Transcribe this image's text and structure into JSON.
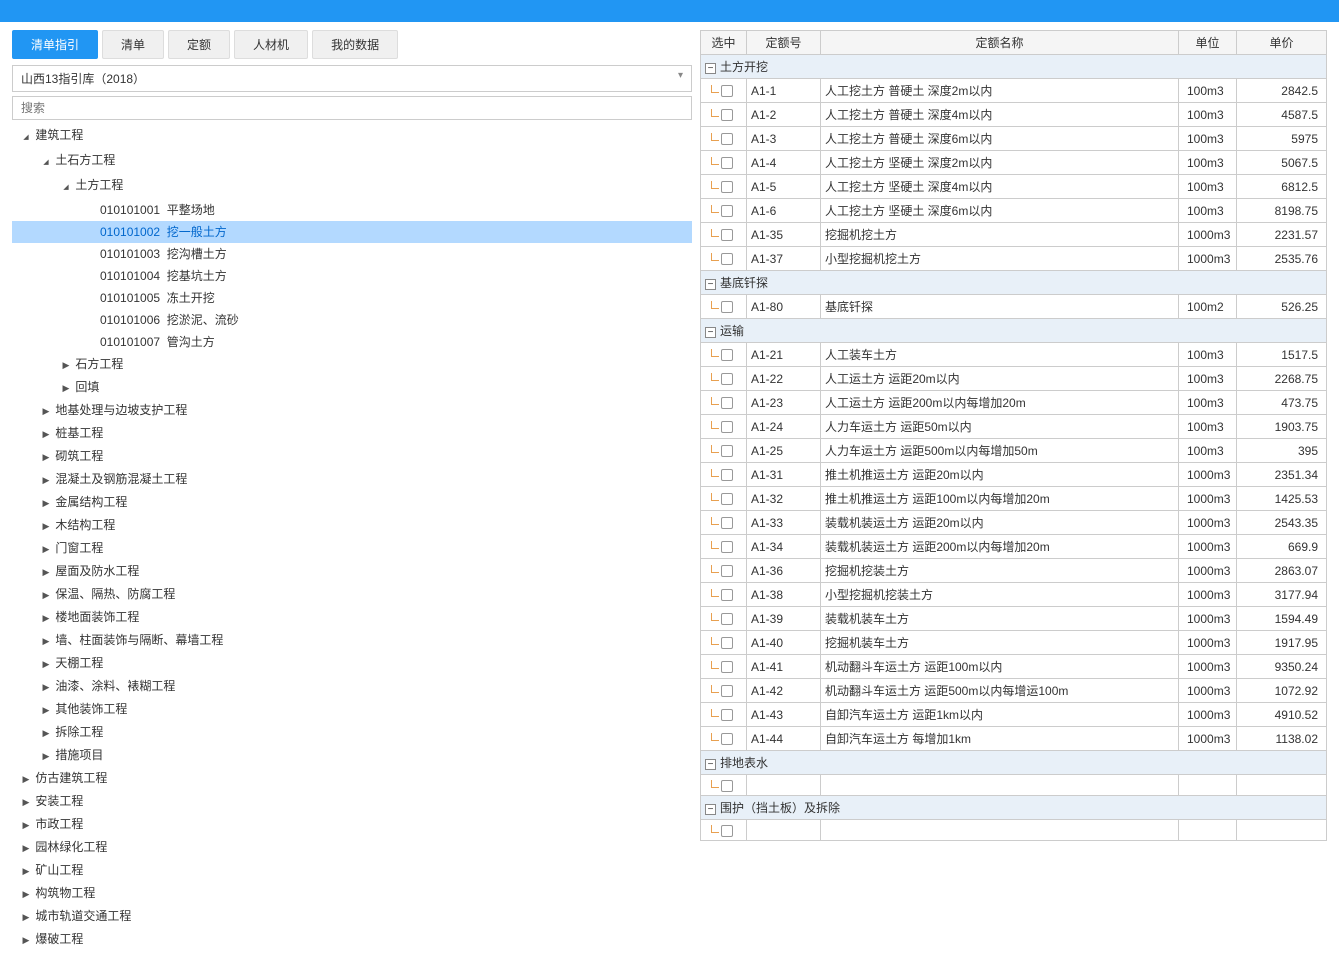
{
  "tabs": [
    "清单指引",
    "清单",
    "定额",
    "人材机",
    "我的数据"
  ],
  "activeTab": 0,
  "library": "山西13指引库（2018）",
  "searchPlaceholder": "搜索",
  "tree": [
    {
      "label": "建筑工程",
      "depth": 0,
      "caret": "open",
      "children": [
        {
          "label": "土石方工程",
          "depth": 1,
          "caret": "open",
          "children": [
            {
              "label": "土方工程",
              "depth": 2,
              "caret": "open",
              "children": [
                {
                  "code": "010101001",
                  "label": "平整场地",
                  "depth": 3
                },
                {
                  "code": "010101002",
                  "label": "挖一般土方",
                  "depth": 3,
                  "selected": true
                },
                {
                  "code": "010101003",
                  "label": "挖沟槽土方",
                  "depth": 3
                },
                {
                  "code": "010101004",
                  "label": "挖基坑土方",
                  "depth": 3
                },
                {
                  "code": "010101005",
                  "label": "冻土开挖",
                  "depth": 3
                },
                {
                  "code": "010101006",
                  "label": "挖淤泥、流砂",
                  "depth": 3
                },
                {
                  "code": "010101007",
                  "label": "管沟土方",
                  "depth": 3
                }
              ]
            },
            {
              "label": "石方工程",
              "depth": 2,
              "caret": "closed"
            },
            {
              "label": "回填",
              "depth": 2,
              "caret": "closed"
            }
          ]
        },
        {
          "label": "地基处理与边坡支护工程",
          "depth": 1,
          "caret": "closed"
        },
        {
          "label": "桩基工程",
          "depth": 1,
          "caret": "closed"
        },
        {
          "label": "砌筑工程",
          "depth": 1,
          "caret": "closed"
        },
        {
          "label": "混凝土及钢筋混凝土工程",
          "depth": 1,
          "caret": "closed"
        },
        {
          "label": "金属结构工程",
          "depth": 1,
          "caret": "closed"
        },
        {
          "label": "木结构工程",
          "depth": 1,
          "caret": "closed"
        },
        {
          "label": "门窗工程",
          "depth": 1,
          "caret": "closed"
        },
        {
          "label": "屋面及防水工程",
          "depth": 1,
          "caret": "closed"
        },
        {
          "label": "保温、隔热、防腐工程",
          "depth": 1,
          "caret": "closed"
        },
        {
          "label": "楼地面装饰工程",
          "depth": 1,
          "caret": "closed"
        },
        {
          "label": "墙、柱面装饰与隔断、幕墙工程",
          "depth": 1,
          "caret": "closed"
        },
        {
          "label": "天棚工程",
          "depth": 1,
          "caret": "closed"
        },
        {
          "label": "油漆、涂料、裱糊工程",
          "depth": 1,
          "caret": "closed"
        },
        {
          "label": "其他装饰工程",
          "depth": 1,
          "caret": "closed"
        },
        {
          "label": "拆除工程",
          "depth": 1,
          "caret": "closed"
        },
        {
          "label": "措施项目",
          "depth": 1,
          "caret": "closed"
        }
      ]
    },
    {
      "label": "仿古建筑工程",
      "depth": 0,
      "caret": "closed"
    },
    {
      "label": "安装工程",
      "depth": 0,
      "caret": "closed"
    },
    {
      "label": "市政工程",
      "depth": 0,
      "caret": "closed"
    },
    {
      "label": "园林绿化工程",
      "depth": 0,
      "caret": "closed"
    },
    {
      "label": "矿山工程",
      "depth": 0,
      "caret": "closed"
    },
    {
      "label": "构筑物工程",
      "depth": 0,
      "caret": "closed"
    },
    {
      "label": "城市轨道交通工程",
      "depth": 0,
      "caret": "closed"
    },
    {
      "label": "爆破工程",
      "depth": 0,
      "caret": "closed"
    }
  ],
  "tableHeaders": {
    "sel": "选中",
    "code": "定额号",
    "name": "定额名称",
    "unit": "单位",
    "price": "单价"
  },
  "groups": [
    {
      "title": "土方开挖",
      "rows": [
        {
          "code": "A1-1",
          "name": "人工挖土方 普硬土 深度2m以内",
          "unit": "100m3",
          "price": "2842.5"
        },
        {
          "code": "A1-2",
          "name": "人工挖土方 普硬土 深度4m以内",
          "unit": "100m3",
          "price": "4587.5"
        },
        {
          "code": "A1-3",
          "name": "人工挖土方 普硬土 深度6m以内",
          "unit": "100m3",
          "price": "5975"
        },
        {
          "code": "A1-4",
          "name": "人工挖土方 坚硬土 深度2m以内",
          "unit": "100m3",
          "price": "5067.5"
        },
        {
          "code": "A1-5",
          "name": "人工挖土方 坚硬土 深度4m以内",
          "unit": "100m3",
          "price": "6812.5"
        },
        {
          "code": "A1-6",
          "name": "人工挖土方 坚硬土 深度6m以内",
          "unit": "100m3",
          "price": "8198.75"
        },
        {
          "code": "A1-35",
          "name": "挖掘机挖土方",
          "unit": "1000m3",
          "price": "2231.57"
        },
        {
          "code": "A1-37",
          "name": "小型挖掘机挖土方",
          "unit": "1000m3",
          "price": "2535.76"
        }
      ]
    },
    {
      "title": "基底钎探",
      "rows": [
        {
          "code": "A1-80",
          "name": "基底钎探",
          "unit": "100m2",
          "price": "526.25"
        }
      ]
    },
    {
      "title": "运输",
      "rows": [
        {
          "code": "A1-21",
          "name": "人工装车土方",
          "unit": "100m3",
          "price": "1517.5"
        },
        {
          "code": "A1-22",
          "name": "人工运土方 运距20m以内",
          "unit": "100m3",
          "price": "2268.75"
        },
        {
          "code": "A1-23",
          "name": "人工运土方 运距200m以内每增加20m",
          "unit": "100m3",
          "price": "473.75"
        },
        {
          "code": "A1-24",
          "name": "人力车运土方 运距50m以内",
          "unit": "100m3",
          "price": "1903.75"
        },
        {
          "code": "A1-25",
          "name": "人力车运土方 运距500m以内每增加50m",
          "unit": "100m3",
          "price": "395"
        },
        {
          "code": "A1-31",
          "name": "推土机推运土方 运距20m以内",
          "unit": "1000m3",
          "price": "2351.34"
        },
        {
          "code": "A1-32",
          "name": "推土机推运土方 运距100m以内每增加20m",
          "unit": "1000m3",
          "price": "1425.53"
        },
        {
          "code": "A1-33",
          "name": "装载机装运土方 运距20m以内",
          "unit": "1000m3",
          "price": "2543.35"
        },
        {
          "code": "A1-34",
          "name": "装载机装运土方 运距200m以内每增加20m",
          "unit": "1000m3",
          "price": "669.9"
        },
        {
          "code": "A1-36",
          "name": "挖掘机挖装土方",
          "unit": "1000m3",
          "price": "2863.07"
        },
        {
          "code": "A1-38",
          "name": "小型挖掘机挖装土方",
          "unit": "1000m3",
          "price": "3177.94"
        },
        {
          "code": "A1-39",
          "name": "装载机装车土方",
          "unit": "1000m3",
          "price": "1594.49"
        },
        {
          "code": "A1-40",
          "name": "挖掘机装车土方",
          "unit": "1000m3",
          "price": "1917.95"
        },
        {
          "code": "A1-41",
          "name": "机动翻斗车运土方 运距100m以内",
          "unit": "1000m3",
          "price": "9350.24"
        },
        {
          "code": "A1-42",
          "name": "机动翻斗车运土方 运距500m以内每增运100m",
          "unit": "1000m3",
          "price": "1072.92"
        },
        {
          "code": "A1-43",
          "name": "自卸汽车运土方 运距1km以内",
          "unit": "1000m3",
          "price": "4910.52"
        },
        {
          "code": "A1-44",
          "name": "自卸汽车运土方 每增加1km",
          "unit": "1000m3",
          "price": "1138.02"
        }
      ]
    },
    {
      "title": "排地表水",
      "rows": [
        {
          "code": "",
          "name": "",
          "unit": "",
          "price": ""
        }
      ]
    },
    {
      "title": "围护（挡土板）及拆除",
      "rows": [
        {
          "code": "",
          "name": "",
          "unit": "",
          "price": ""
        }
      ]
    }
  ]
}
